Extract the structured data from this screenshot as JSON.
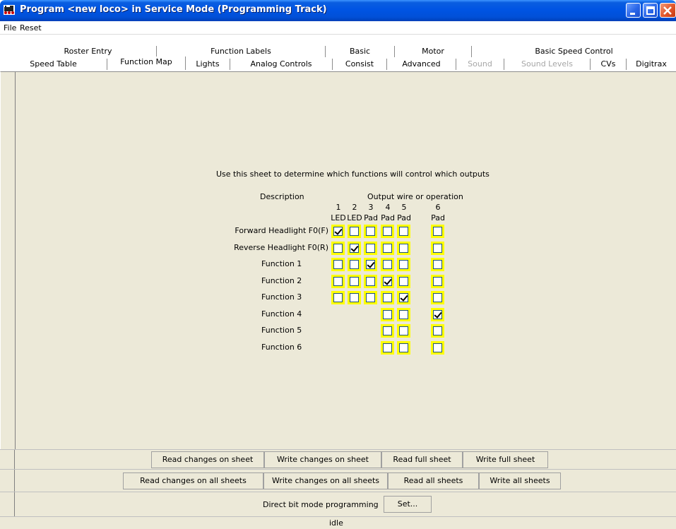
{
  "window": {
    "title": "Program <new loco> in Service Mode (Programming Track)",
    "icon": "locomotive-icon"
  },
  "menu": [
    "File",
    "Reset"
  ],
  "tabs": {
    "row1": [
      "Roster Entry",
      "Function Labels",
      "Basic",
      "Motor",
      "Basic Speed Control"
    ],
    "row2": [
      "Speed Table",
      "Function Map",
      "Lights",
      "Analog Controls",
      "Consist",
      "Advanced",
      "Sound",
      "Sound Levels",
      "CVs",
      "Digitrax"
    ],
    "selected": "Function Map",
    "disabled": [
      "Sound",
      "Sound Levels"
    ]
  },
  "sheet": {
    "intro": "Use this sheet to determine which functions will control which outputs",
    "description_header": "Description",
    "output_header": "Output wire or operation",
    "outputs": [
      {
        "num": "1",
        "type": "LED"
      },
      {
        "num": "2",
        "type": "LED"
      },
      {
        "num": "3",
        "type": "Pad"
      },
      {
        "num": "4",
        "type": "Pad"
      },
      {
        "num": "5",
        "type": "Pad"
      },
      {
        "num": "6",
        "type": "Pad"
      }
    ],
    "rows": [
      {
        "label": "Forward Headlight F0(F)",
        "cells": [
          true,
          false,
          false,
          false,
          false,
          false
        ]
      },
      {
        "label": "Reverse Headlight F0(R)",
        "cells": [
          false,
          true,
          false,
          false,
          false,
          false
        ]
      },
      {
        "label": "Function 1",
        "cells": [
          false,
          false,
          true,
          false,
          false,
          false
        ]
      },
      {
        "label": "Function 2",
        "cells": [
          false,
          false,
          false,
          true,
          false,
          false
        ]
      },
      {
        "label": "Function 3",
        "cells": [
          false,
          false,
          false,
          false,
          true,
          false
        ]
      },
      {
        "label": "Function 4",
        "cells": [
          null,
          null,
          null,
          false,
          false,
          true
        ]
      },
      {
        "label": "Function 5",
        "cells": [
          null,
          null,
          null,
          false,
          false,
          false
        ]
      },
      {
        "label": "Function 6",
        "cells": [
          null,
          null,
          null,
          false,
          false,
          false
        ]
      }
    ]
  },
  "buttons": {
    "read_changes_sheet": "Read changes on sheet",
    "write_changes_sheet": "Write changes on sheet",
    "read_full_sheet": "Read full sheet",
    "write_full_sheet": "Write full sheet",
    "read_changes_all": "Read changes on all sheets",
    "write_changes_all": "Write changes on all sheets",
    "read_all": "Read all sheets",
    "write_all": "Write all sheets",
    "mode_label": "Direct bit mode programming",
    "set": "Set..."
  },
  "status": "idle",
  "colors": {
    "titlebar": "#0054e3",
    "highlight": "#ffff00",
    "panel": "#ece9d8"
  }
}
